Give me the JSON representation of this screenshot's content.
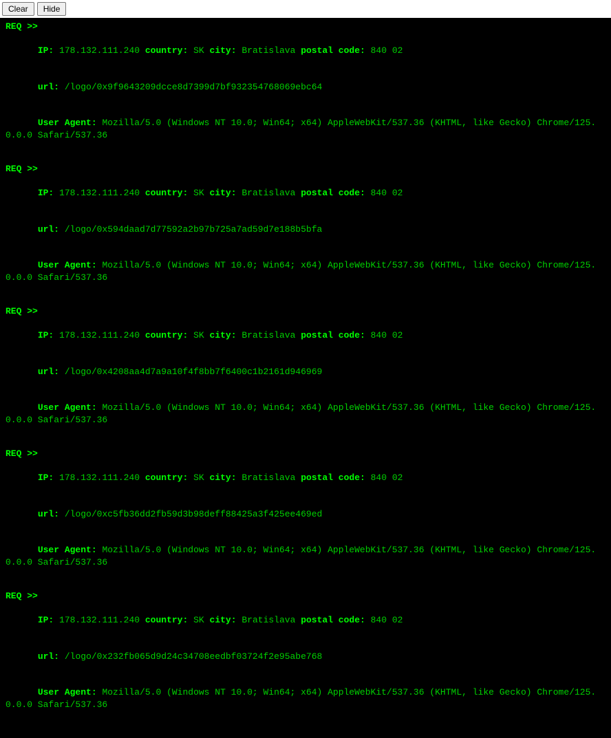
{
  "toolbar": {
    "clear_label": "Clear",
    "hide_label": "Hide"
  },
  "labels": {
    "req_marker": "REQ >>",
    "ip": "IP:",
    "country": "country:",
    "city": "city:",
    "postal": "postal code:",
    "url": "url:",
    "user_agent": "User Agent:"
  },
  "entries": [
    {
      "ip": "178.132.111.240",
      "country": "SK",
      "city": "Bratislava",
      "postal": "840 02",
      "url": "/logo/0x9f9643209dcce8d7399d7bf932354768069ebc64",
      "user_agent": "Mozilla/5.0 (Windows NT 10.0; Win64; x64) AppleWebKit/537.36 (KHTML, like Gecko) Chrome/125.0.0.0 Safari/537.36"
    },
    {
      "ip": "178.132.111.240",
      "country": "SK",
      "city": "Bratislava",
      "postal": "840 02",
      "url": "/logo/0x594daad7d77592a2b97b725a7ad59d7e188b5bfa",
      "user_agent": "Mozilla/5.0 (Windows NT 10.0; Win64; x64) AppleWebKit/537.36 (KHTML, like Gecko) Chrome/125.0.0.0 Safari/537.36"
    },
    {
      "ip": "178.132.111.240",
      "country": "SK",
      "city": "Bratislava",
      "postal": "840 02",
      "url": "/logo/0x4208aa4d7a9a10f4f8bb7f6400c1b2161d946969",
      "user_agent": "Mozilla/5.0 (Windows NT 10.0; Win64; x64) AppleWebKit/537.36 (KHTML, like Gecko) Chrome/125.0.0.0 Safari/537.36"
    },
    {
      "ip": "178.132.111.240",
      "country": "SK",
      "city": "Bratislava",
      "postal": "840 02",
      "url": "/logo/0xc5fb36dd2fb59d3b98deff88425a3f425ee469ed",
      "user_agent": "Mozilla/5.0 (Windows NT 10.0; Win64; x64) AppleWebKit/537.36 (KHTML, like Gecko) Chrome/125.0.0.0 Safari/537.36"
    },
    {
      "ip": "178.132.111.240",
      "country": "SK",
      "city": "Bratislava",
      "postal": "840 02",
      "url": "/logo/0x232fb065d9d24c34708eedbf03724f2e95abe768",
      "user_agent": "Mozilla/5.0 (Windows NT 10.0; Win64; x64) AppleWebKit/537.36 (KHTML, like Gecko) Chrome/125.0.0.0 Safari/537.36"
    }
  ]
}
